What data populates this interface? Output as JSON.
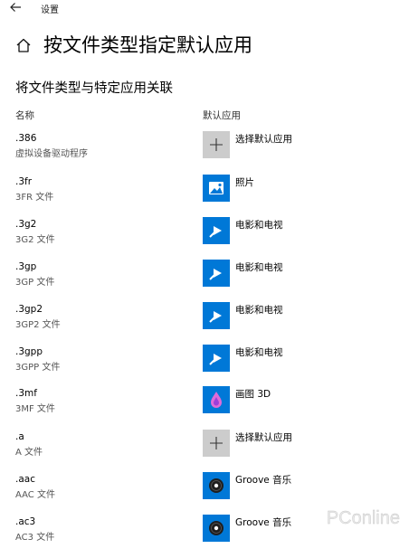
{
  "window": {
    "title": "设置"
  },
  "page": {
    "title": "按文件类型指定默认应用",
    "section_title": "将文件类型与特定应用关联",
    "col_name": "名称",
    "col_app": "默认应用"
  },
  "rows": [
    {
      "ext": ".386",
      "desc": "虚拟设备驱动程序",
      "app": "选择默认应用",
      "icon": "plus-icon"
    },
    {
      "ext": ".3fr",
      "desc": "3FR 文件",
      "app": "照片",
      "icon": "photos-icon"
    },
    {
      "ext": ".3g2",
      "desc": "3G2 文件",
      "app": "电影和电视",
      "icon": "movies-tv-icon"
    },
    {
      "ext": ".3gp",
      "desc": "3GP 文件",
      "app": "电影和电视",
      "icon": "movies-tv-icon"
    },
    {
      "ext": ".3gp2",
      "desc": "3GP2 文件",
      "app": "电影和电视",
      "icon": "movies-tv-icon"
    },
    {
      "ext": ".3gpp",
      "desc": "3GPP 文件",
      "app": "电影和电视",
      "icon": "movies-tv-icon"
    },
    {
      "ext": ".3mf",
      "desc": "3MF 文件",
      "app": "画图 3D",
      "icon": "paint-3d-icon"
    },
    {
      "ext": ".a",
      "desc": "A 文件",
      "app": "选择默认应用",
      "icon": "plus-icon"
    },
    {
      "ext": ".aac",
      "desc": "AAC 文件",
      "app": "Groove 音乐",
      "icon": "groove-music-icon"
    },
    {
      "ext": ".ac3",
      "desc": "AC3 文件",
      "app": "Groove 音乐",
      "icon": "groove-music-icon"
    }
  ],
  "watermark": {
    "text": "PConline"
  },
  "colors": {
    "accent": "#0078d7",
    "placeholder_tile": "#cccccc"
  }
}
